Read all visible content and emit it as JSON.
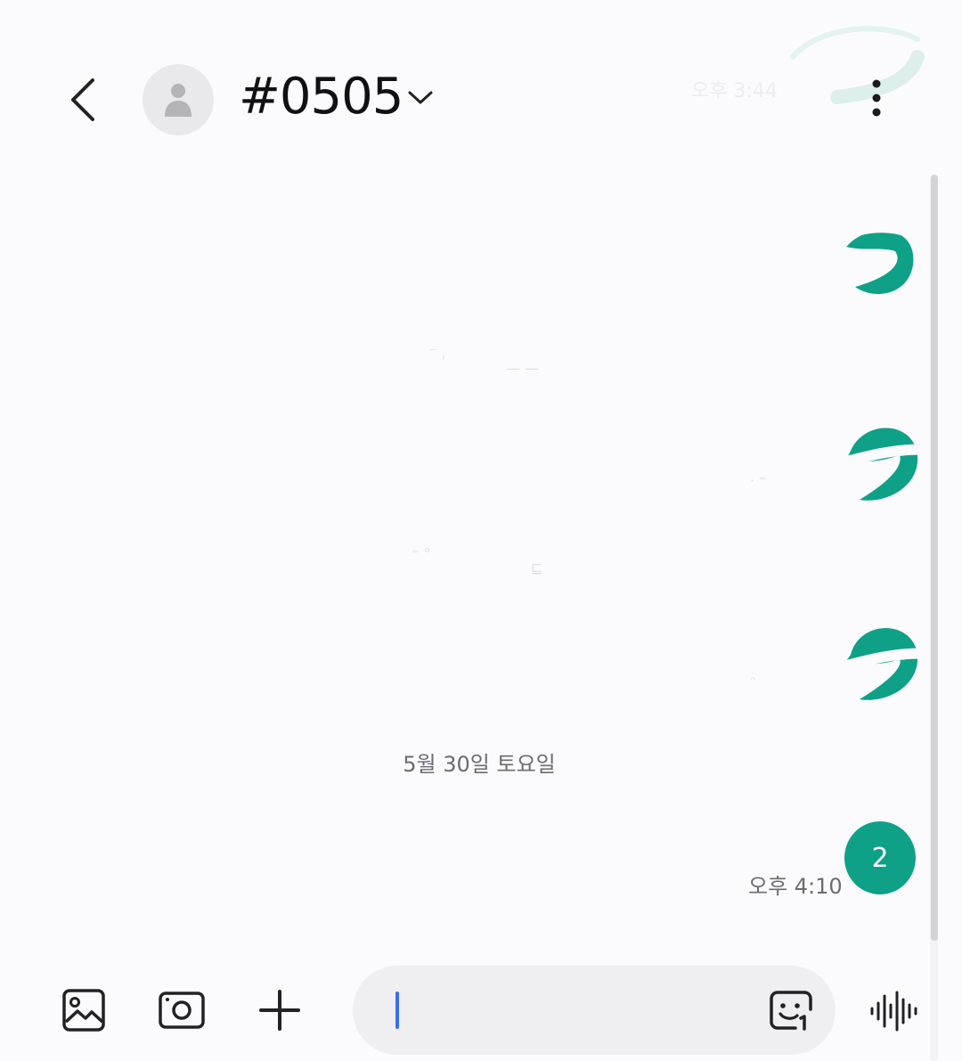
{
  "header": {
    "title": "#0505",
    "time": "오후 3:44"
  },
  "conversation": {
    "date_separator": "5월 30일 토요일",
    "last_message": {
      "text": "2",
      "time": "오후 4:10"
    }
  },
  "composer": {
    "input_value": ""
  },
  "colors": {
    "accent": "#0ea187",
    "caret": "#3a6ff0",
    "background": "#fbfbfd",
    "input_background": "#efeff1",
    "meta_text": "#6b6b70"
  },
  "icons": {
    "back": "chevron-left-icon",
    "avatar": "person-icon",
    "title_dropdown": "chevron-down-icon",
    "more": "more-vertical-icon",
    "gallery": "image-icon",
    "camera": "camera-icon",
    "attach": "plus-icon",
    "sticker": "emoji-sticker-icon",
    "voice": "voice-waveform-icon"
  }
}
